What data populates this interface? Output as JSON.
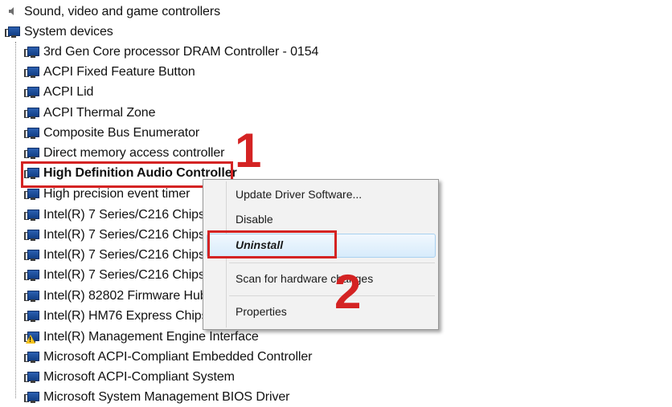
{
  "tree": {
    "categories": [
      {
        "label": "Sound, video and game controllers"
      },
      {
        "label": "System devices"
      }
    ],
    "devices": [
      {
        "label": "3rd Gen Core processor DRAM Controller - 0154",
        "warning": false
      },
      {
        "label": "ACPI Fixed Feature Button",
        "warning": false
      },
      {
        "label": "ACPI Lid",
        "warning": false
      },
      {
        "label": "ACPI Thermal Zone",
        "warning": false
      },
      {
        "label": "Composite Bus Enumerator",
        "warning": false
      },
      {
        "label": "Direct memory access controller",
        "warning": false
      },
      {
        "label": "High Definition Audio Controller",
        "warning": false,
        "selected": true
      },
      {
        "label": "High precision event timer",
        "warning": false
      },
      {
        "label": "Intel(R) 7 Series/C216 Chipset",
        "warning": false
      },
      {
        "label": "Intel(R) 7 Series/C216 Chipset",
        "warning": false
      },
      {
        "label": "Intel(R) 7 Series/C216 Chipset",
        "warning": false
      },
      {
        "label": "Intel(R) 7 Series/C216 Chipset",
        "warning": false
      },
      {
        "label": "Intel(R) 82802 Firmware Hub D",
        "warning": false
      },
      {
        "label": "Intel(R) HM76 Express Chipset",
        "warning": false
      },
      {
        "label": "Intel(R) Management Engine Interface",
        "warning": true
      },
      {
        "label": "Microsoft ACPI-Compliant Embedded Controller",
        "warning": false
      },
      {
        "label": "Microsoft ACPI-Compliant System",
        "warning": false
      },
      {
        "label": "Microsoft System Management BIOS Driver",
        "warning": false
      }
    ]
  },
  "context_menu": {
    "update_driver": "Update Driver Software...",
    "disable": "Disable",
    "uninstall": "Uninstall",
    "scan": "Scan for hardware changes",
    "properties": "Properties"
  },
  "callouts": {
    "step1": "1",
    "step2": "2"
  },
  "colors": {
    "callout_red": "#d42323",
    "menu_highlight": "#d7ebfb"
  }
}
